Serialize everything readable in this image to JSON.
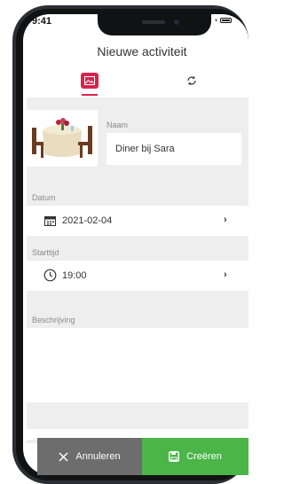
{
  "status_bar": {
    "time": "9:41"
  },
  "header": {
    "title": "Nieuwe activiteit"
  },
  "tabs": [
    {
      "icon": "image-icon",
      "active": true
    },
    {
      "icon": "sync-icon",
      "active": false
    }
  ],
  "form": {
    "name_label": "Naam",
    "name_value": "Diner bij Sara",
    "date_label": "Datum",
    "date_value": "2021-02-04",
    "time_label": "Starttijd",
    "time_value": "19:00",
    "description_label": "Beschrijving",
    "description_value": ""
  },
  "actions": {
    "cancel_label": "Annuleren",
    "create_label": "Creëren"
  },
  "colors": {
    "accent": "#d6244f",
    "create": "#4bb548",
    "cancel": "#6d6d6d"
  }
}
